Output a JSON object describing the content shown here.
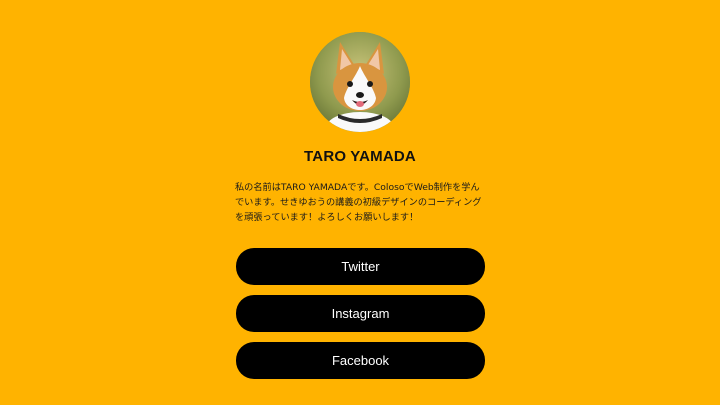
{
  "profile": {
    "name": "TARO YAMADA",
    "bio": "私の名前はTARO YAMADAです。ColosoでWeb制作を学んでいます。せきゆおうの講義の初級デザインのコーディングを頑張っています！よろしくお願いします！"
  },
  "links": [
    {
      "label": "Twitter"
    },
    {
      "label": "Instagram"
    },
    {
      "label": "Facebook"
    }
  ],
  "colors": {
    "background": "#FFB300",
    "button": "#000000",
    "button_text": "#FFFFFF"
  }
}
